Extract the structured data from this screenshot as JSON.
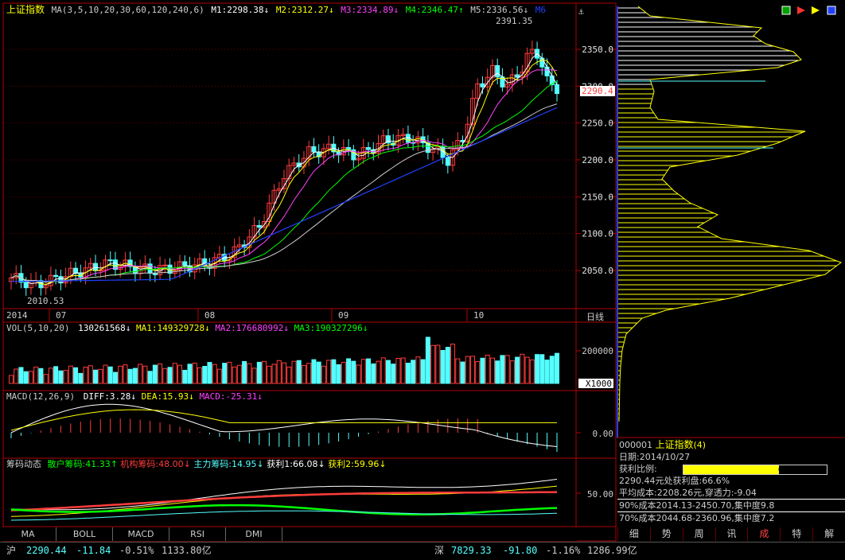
{
  "chart_header": {
    "title": "上证指数",
    "ma_params": "MA(3,5,10,20,30,60,120,240,6)",
    "m1": "M1:2298.38↓",
    "m2": "M2:2312.27↓",
    "m3": "M3:2334.89↓",
    "m4": "M4:2346.47↑",
    "m5": "M5:2336.56↓",
    "m6": "M6"
  },
  "price_labels": {
    "high": "2391.35",
    "low": "2010.53",
    "current": "2290.4"
  },
  "price_axis": [
    "2350.0",
    "2300.0",
    "2250.0",
    "2200.0",
    "2150.0",
    "2100.0",
    "2050.0"
  ],
  "date_axis": {
    "year": "2014",
    "months": [
      "07",
      "08",
      "09",
      "10"
    ],
    "period": "日线"
  },
  "vol_header": {
    "params": "VOL(5,10,20)",
    "value": "130261568↓",
    "ma1": "MA1:149329728↓",
    "ma2": "MA2:176680992↓",
    "ma3": "MA3:190327296↓"
  },
  "vol_axis": {
    "tick": "200000",
    "unit": "X1000"
  },
  "macd_header": {
    "params": "MACD(12,26,9)",
    "diff": "DIFF:3.28↓",
    "dea": "DEA:15.93↓",
    "macd": "MACD:-25.31↓"
  },
  "macd_axis": {
    "tick": "0.00"
  },
  "chip_header": {
    "title": "筹码动态",
    "retail": "散户筹码:41.33↑",
    "inst": "机构筹码:48.00↓",
    "main": "主力筹码:14.95↓",
    "profit1": "获利1:66.08↓",
    "profit2": "获利2:59.96↓"
  },
  "chip_axis": {
    "tick": "50.00"
  },
  "bottom_tabs": [
    "MA",
    "BOLL",
    "MACD",
    "RSI",
    "DMI"
  ],
  "right_tabs": [
    "细",
    "势",
    "周",
    "讯",
    "成",
    "特",
    "解"
  ],
  "right_tab_active": "成",
  "cyq_axis": [
    "2350.0",
    "2300.0",
    "2250.0",
    "2200.0",
    "2150.0",
    "2100.0",
    "2050.0"
  ],
  "info_panel": {
    "code": "000001",
    "name": "上证指数",
    "count": "(4)",
    "date": "日期:2014/10/27",
    "profit_label": "获利比例:",
    "profit_pct": "66.6%",
    "profit_fraction": 0.666,
    "line1": "2290.44元处获利盘:66.6%",
    "line2": "平均成本:2208.26元,穿透力:-9.04",
    "line3": "90%成本2014.13-2450.70,集中度9.8",
    "line4": "70%成本2044.68-2360.96,集中度7.2"
  },
  "status_bar": {
    "sh_label": "沪",
    "sh_price": "2290.44",
    "sh_change": "-11.84",
    "sh_pct": "-0.51%",
    "sh_amount": "1133.80亿",
    "sz_label": "深",
    "sz_price": "7829.33",
    "sz_change": "-91.80",
    "sz_pct": "-1.16%",
    "sz_amount": "1286.99亿"
  },
  "colors": {
    "up": "#ff3c3c",
    "down": "#54ffff",
    "ma1": "#ffffff",
    "ma2": "#ffff00",
    "ma3": "#ff40ff",
    "ma4": "#00ff00",
    "ma5": "#cccccc",
    "ma6": "#2040ff",
    "axis": "#b00000"
  }
}
